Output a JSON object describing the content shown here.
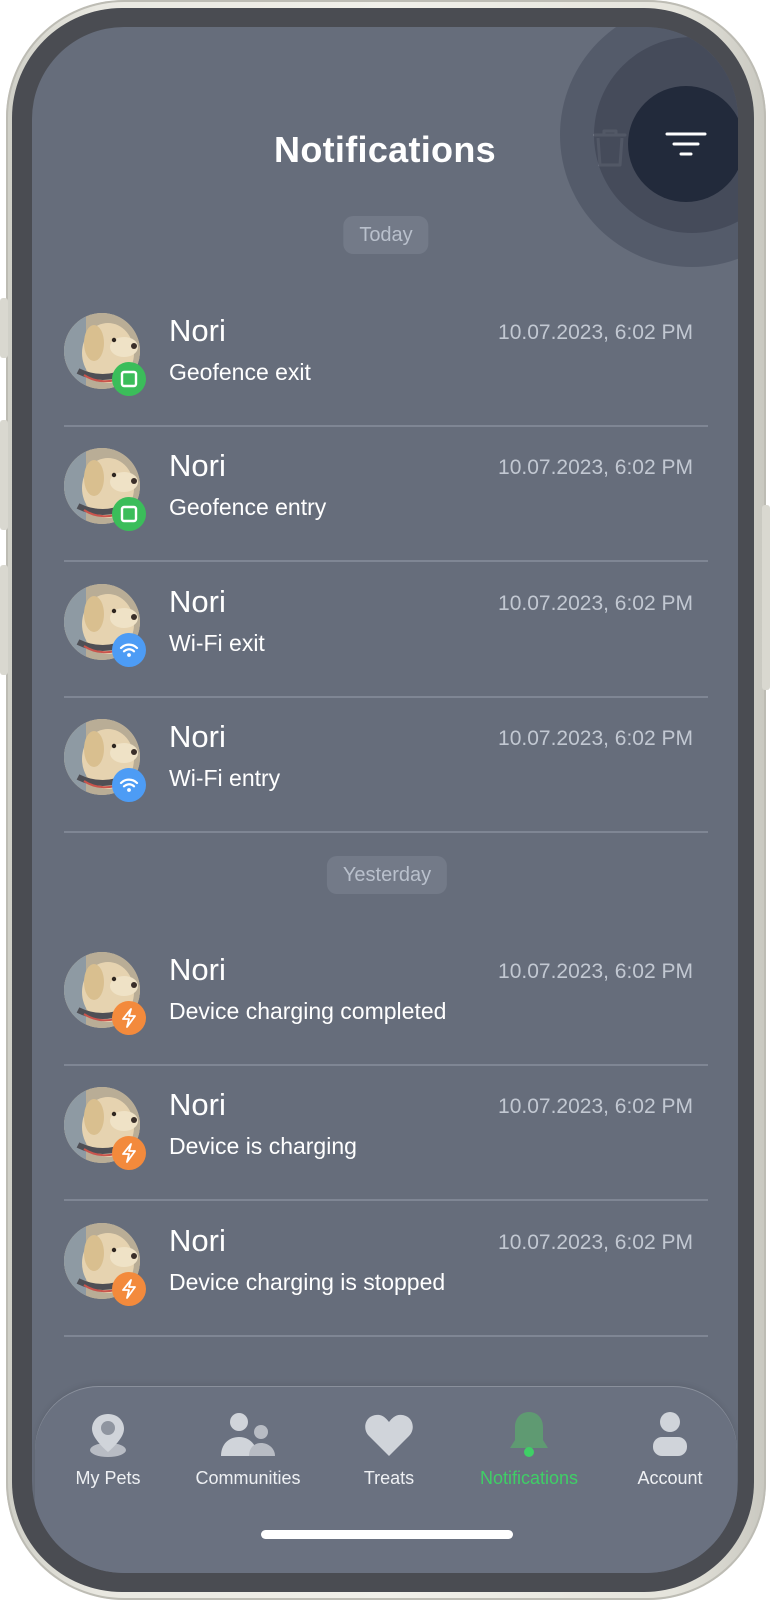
{
  "header": {
    "title": "Notifications"
  },
  "sections": [
    {
      "label": "Today"
    },
    {
      "label": "Yesterday"
    }
  ],
  "notifications": [
    {
      "pet": "Nori",
      "event": "Geofence exit",
      "time": "10.07.2023, 6:02 PM",
      "badge": "geofence-icon",
      "badge_color": "#3bbd5a"
    },
    {
      "pet": "Nori",
      "event": "Geofence entry",
      "time": "10.07.2023, 6:02 PM",
      "badge": "geofence-icon",
      "badge_color": "#3bbd5a"
    },
    {
      "pet": "Nori",
      "event": "Wi-Fi exit",
      "time": "10.07.2023, 6:02 PM",
      "badge": "wifi-icon",
      "badge_color": "#4d9cf5"
    },
    {
      "pet": "Nori",
      "event": "Wi-Fi entry",
      "time": "10.07.2023, 6:02 PM",
      "badge": "wifi-icon",
      "badge_color": "#4d9cf5"
    },
    {
      "pet": "Nori",
      "event": "Device charging completed",
      "time": "10.07.2023, 6:02 PM",
      "badge": "lightning-icon",
      "badge_color": "#f38a3c"
    },
    {
      "pet": "Nori",
      "event": "Device is charging",
      "time": "10.07.2023, 6:02 PM",
      "badge": "lightning-icon",
      "badge_color": "#f38a3c"
    },
    {
      "pet": "Nori",
      "event": "Device charging is stopped",
      "time": "10.07.2023, 6:02 PM",
      "badge": "lightning-icon",
      "badge_color": "#f38a3c"
    }
  ],
  "tabs": [
    {
      "label": "My Pets",
      "icon": "map-pin-icon"
    },
    {
      "label": "Communities",
      "icon": "people-icon"
    },
    {
      "label": "Treats",
      "icon": "heart-icon"
    },
    {
      "label": "Notifications",
      "icon": "bell-icon",
      "active": true
    },
    {
      "label": "Account",
      "icon": "person-icon"
    }
  ],
  "colors": {
    "background": "#666d7b",
    "accent_active": "#3fcf66",
    "filter_button": "#222a3b"
  }
}
